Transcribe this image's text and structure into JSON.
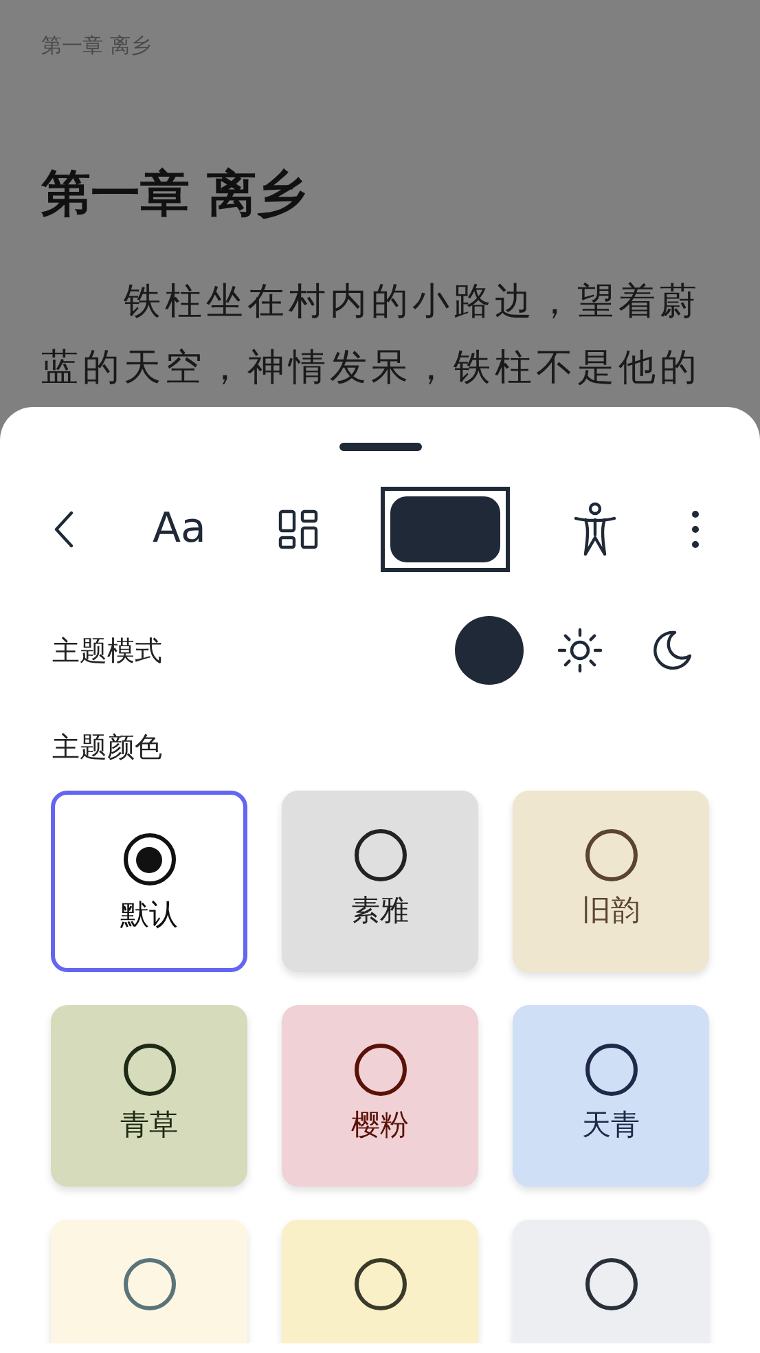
{
  "reader": {
    "running_header": "第一章 离乡",
    "chapter_title": "第一章 离乡",
    "paragraph": "铁柱坐在村内的小路边，望着蔚蓝的天空，神情发呆，铁柱不是他的"
  },
  "toolbar": [
    {
      "kind": "back",
      "selected": false
    },
    {
      "kind": "font",
      "label": "Aa",
      "selected": false
    },
    {
      "kind": "layout",
      "selected": false
    },
    {
      "kind": "theme",
      "selected": true
    },
    {
      "kind": "accessibility",
      "selected": false
    },
    {
      "kind": "more",
      "selected": false
    }
  ],
  "theme_mode": {
    "label": "主题模式",
    "options": [
      {
        "kind": "system",
        "selected": true
      },
      {
        "kind": "light",
        "selected": false
      },
      {
        "kind": "dark",
        "selected": false
      }
    ]
  },
  "theme_color": {
    "label": "主题颜色",
    "swatches": [
      {
        "label": "默认",
        "color": "#ffffff",
        "radio": {
          "color": "#111111"
        },
        "selected": true
      },
      {
        "label": "素雅",
        "color": "#dfdfdf",
        "radio": {
          "color": "#222222"
        },
        "selected": false
      },
      {
        "label": "旧韵",
        "color": "#efe6cf",
        "radio": {
          "color": "#5a4434"
        },
        "selected": false
      },
      {
        "label": "青草",
        "color": "#d6dbbb",
        "radio": {
          "color": "#1e2a14"
        },
        "selected": false
      },
      {
        "label": "樱粉",
        "color": "#f0d2d6",
        "radio": {
          "color": "#5a1208"
        },
        "selected": false
      },
      {
        "label": "天青",
        "color": "#cfdff5",
        "radio": {
          "color": "#1f2a4a"
        },
        "selected": false
      },
      {
        "color": "#fdf6e3",
        "radio": {
          "color": "#5a7479"
        },
        "selected": false
      },
      {
        "color": "#faf0c7",
        "radio": {
          "color": "#3a3a2a"
        },
        "selected": false
      },
      {
        "color": "#eceef2",
        "radio": {
          "color": "#2a303a"
        },
        "selected": false
      }
    ]
  }
}
